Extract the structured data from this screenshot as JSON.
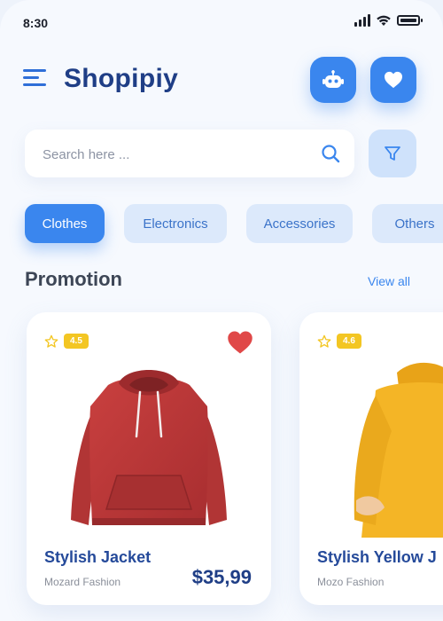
{
  "status_bar": {
    "time": "8:30"
  },
  "header": {
    "app_title": "Shopipiy",
    "icons": {
      "menu": "menu-icon",
      "bot": "robot-icon",
      "favorites": "heart-icon"
    }
  },
  "search": {
    "placeholder": "Search here ...",
    "value": ""
  },
  "categories": [
    {
      "label": "Clothes",
      "active": true
    },
    {
      "label": "Electronics",
      "active": false
    },
    {
      "label": "Accessories",
      "active": false
    },
    {
      "label": "Others",
      "active": false
    }
  ],
  "promotion": {
    "title": "Promotion",
    "view_all_label": "View all",
    "products": [
      {
        "name": "Stylish Jacket",
        "brand": "Mozard Fashion",
        "price": "$35,99",
        "rating": "4.5",
        "favorited": true,
        "image": "red-hoodie"
      },
      {
        "name": "Stylish Yellow J",
        "brand": "Mozo Fashion",
        "price": "",
        "rating": "4.6",
        "favorited": false,
        "image": "yellow-sweater"
      }
    ]
  },
  "colors": {
    "primary": "#3a86ee",
    "title": "#1f3e86",
    "chip_bg": "#dce9fb",
    "rating_badge": "#f3c623",
    "heart": "#e04848"
  }
}
